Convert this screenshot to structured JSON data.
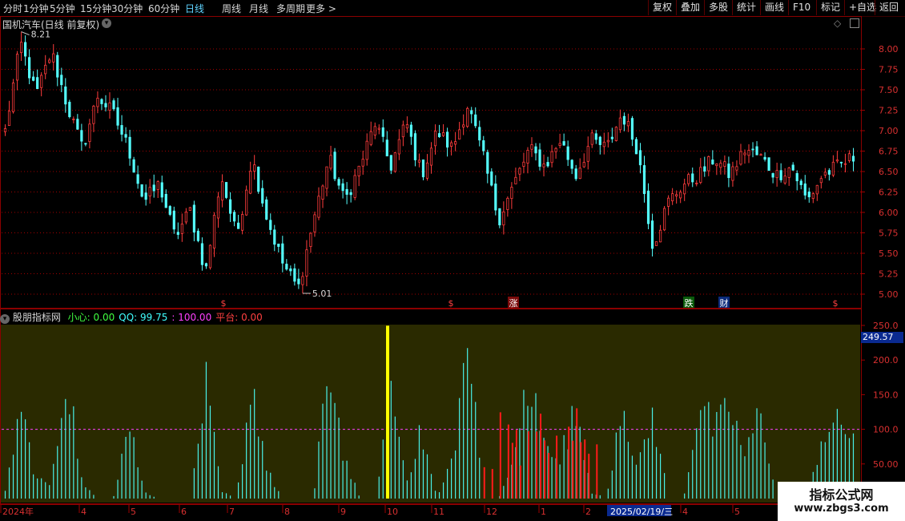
{
  "toolbar": {
    "periods": [
      "分时",
      "1分钟",
      "5分钟",
      "15分钟",
      "30分钟",
      "60分钟",
      "日线",
      "周线",
      "月线",
      "多周期",
      "更多 >"
    ],
    "active_period": "日线",
    "buttons": [
      "复权",
      "叠加",
      "多股",
      "统计",
      "画线",
      "F10",
      "标记",
      "+自选",
      "返回"
    ]
  },
  "main_chart": {
    "title": "国机汽车(日线 前复权)",
    "price_ticks": [
      "8.00",
      "7.75",
      "7.50",
      "7.25",
      "7.00",
      "6.75",
      "6.50",
      "6.25",
      "6.00",
      "5.75",
      "5.50",
      "5.25",
      "5.00"
    ],
    "high_label": "8.21",
    "low_label": "5.01",
    "event_markers": [
      {
        "text": "$",
        "color": "#ff4040"
      },
      {
        "text": "$",
        "color": "#ff4040"
      },
      {
        "text": "涨",
        "color": "#ffffff"
      },
      {
        "text": "跌",
        "color": "#ffffff"
      },
      {
        "text": "财",
        "color": "#ffffff"
      },
      {
        "text": "$",
        "color": "#ff4040"
      }
    ]
  },
  "indicator": {
    "name": "股朋指标网",
    "items": [
      {
        "label": "小心:",
        "value": "0.00",
        "color": "#40ff40"
      },
      {
        "label": "QQ:",
        "value": "99.75",
        "color": "#40ffff"
      },
      {
        "label": ":",
        "value": "100.00",
        "color": "#ff40ff"
      },
      {
        "label": "平台:",
        "value": "0.00",
        "color": "#ff4040"
      }
    ],
    "ticks": [
      "250.0",
      "200.0",
      "150.0",
      "100.0",
      "50.00"
    ],
    "current_value": "249.57"
  },
  "time_axis": {
    "labels": [
      "2024年",
      "4",
      "5",
      "6",
      "7",
      "8",
      "9",
      "10",
      "11",
      "12",
      "1",
      "2",
      "4",
      "5"
    ],
    "cursor_date": "2025/02/19/三"
  },
  "watermark": {
    "title": "指标公式网",
    "url": "www.zbgs3.com"
  },
  "chart_data": {
    "type": "candlestick",
    "title": "国机汽车(日线 前复权)",
    "ylim": [
      5.0,
      8.25
    ],
    "yticks": [
      5.0,
      5.25,
      5.5,
      5.75,
      6.0,
      6.25,
      6.5,
      6.75,
      7.0,
      7.25,
      7.5,
      7.75,
      8.0
    ],
    "anchor_close_prices": [
      6.8,
      7.8,
      7.2,
      7.7,
      7.1,
      6.6,
      7.2,
      7.0,
      6.6,
      6.0,
      6.2,
      5.6,
      5.9,
      5.2,
      6.3,
      5.6,
      6.5,
      5.8,
      5.3,
      5.01,
      5.8,
      6.5,
      6.0,
      6.4,
      6.9,
      6.4,
      6.9,
      6.3,
      6.8,
      6.6,
      7.1,
      6.5,
      5.8,
      6.2,
      6.6,
      6.4,
      6.7,
      6.3,
      6.7,
      6.6,
      7.0,
      6.6,
      5.5,
      6.0,
      6.2,
      6.3,
      6.5,
      6.3,
      6.6,
      6.5,
      6.3,
      6.4,
      6.0,
      6.3,
      6.4,
      6.5
    ],
    "high": 8.21,
    "low": 5.01,
    "indicator": {
      "name": "股朋指标网",
      "ylim": [
        0,
        250
      ],
      "reference_line": 100,
      "qq_anchor_values": [
        10,
        140,
        30,
        20,
        200,
        20,
        0,
        0,
        120,
        10,
        0,
        0,
        0,
        170,
        10,
        0,
        180,
        40,
        0,
        0,
        0,
        210,
        60,
        0,
        0,
        175,
        30,
        100,
        0,
        60,
        240,
        0,
        0,
        60,
        180,
        80,
        60,
        140,
        10,
        0,
        160,
        40,
        130,
        0,
        0,
        150,
        100,
        140,
        60,
        140,
        0,
        0,
        0,
        100,
        110,
        100
      ],
      "peak_value": 249.57
    }
  }
}
